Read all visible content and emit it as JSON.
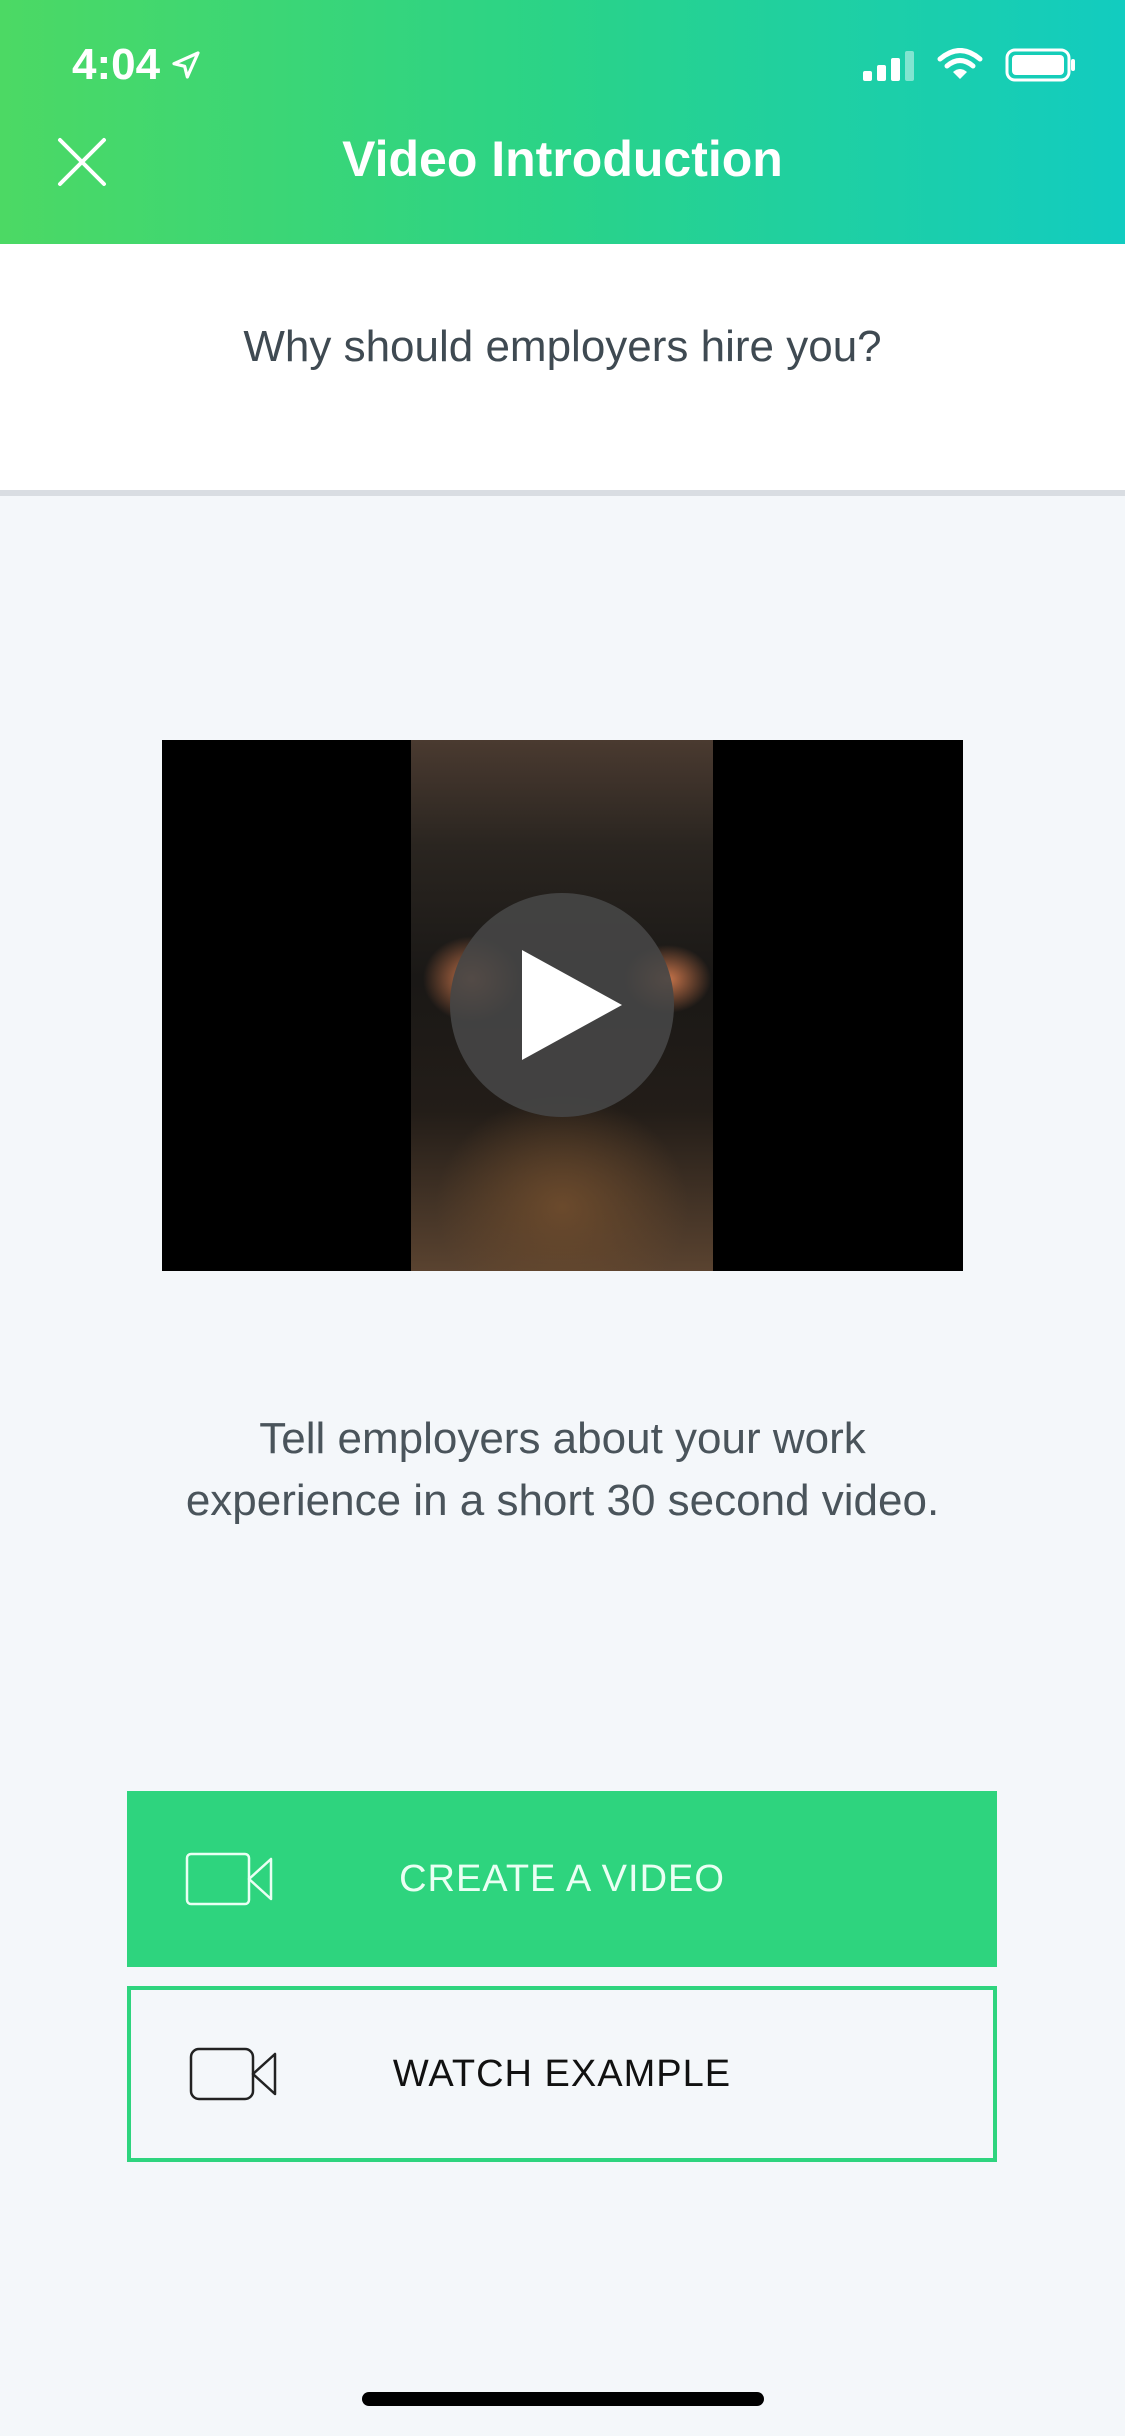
{
  "status_bar": {
    "time": "4:04",
    "icons": [
      "location-arrow-icon",
      "signal-icon",
      "wifi-icon",
      "battery-icon"
    ]
  },
  "header": {
    "title": "Video Introduction",
    "close_icon": "close-icon",
    "gradient_colors": [
      "#4cd964",
      "#12ccc0"
    ]
  },
  "question": {
    "text": "Why should employers hire you?"
  },
  "video": {
    "play_icon": "play-icon"
  },
  "description": {
    "line1": "Tell employers about your work",
    "line2": "experience in a short 30 second video."
  },
  "buttons": {
    "create_label": "CREATE A VIDEO",
    "watch_label": "WATCH EXAMPLE",
    "icon": "video-camera-icon",
    "accent_color": "#2ed47e"
  }
}
